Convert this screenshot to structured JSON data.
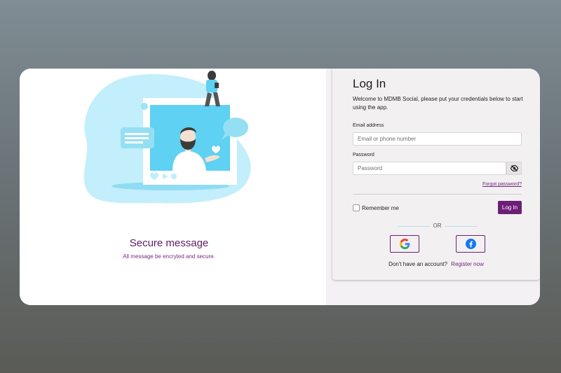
{
  "illustration": {
    "name": "secure-message-illustration",
    "colors": {
      "blob": "#c3eefb",
      "accent": "#5fd1f2",
      "heart": "#ffffff",
      "ring": "#7ad5f0"
    }
  },
  "promo": {
    "title": "Secure message",
    "description": "All message be encryted and secure."
  },
  "login": {
    "title": "Log In",
    "welcome": "Welcome to MDMB Social, please put your credentials below to start using the app.",
    "email_label": "Email address",
    "email_placeholder": "Email or phone number",
    "email_value": "",
    "password_label": "Password",
    "password_placeholder": "Password",
    "password_value": "",
    "password_toggle_icon": "eye-slash-icon",
    "forgot_label": "Forgot password?",
    "remember_label": "Remember me",
    "remember_checked": false,
    "login_button": "Log In",
    "or_label": "OR",
    "google_icon": "google-icon",
    "facebook_icon": "facebook-icon",
    "no_account_text": "Don't have an account?",
    "register_label": "Register now"
  },
  "colors": {
    "brand_purple": "#6d1f78",
    "link_purple": "#6f2878",
    "panel_bg": "#f3f0f2",
    "backdrop_top": "#7f8d94",
    "backdrop_bottom": "#5a5b56"
  }
}
